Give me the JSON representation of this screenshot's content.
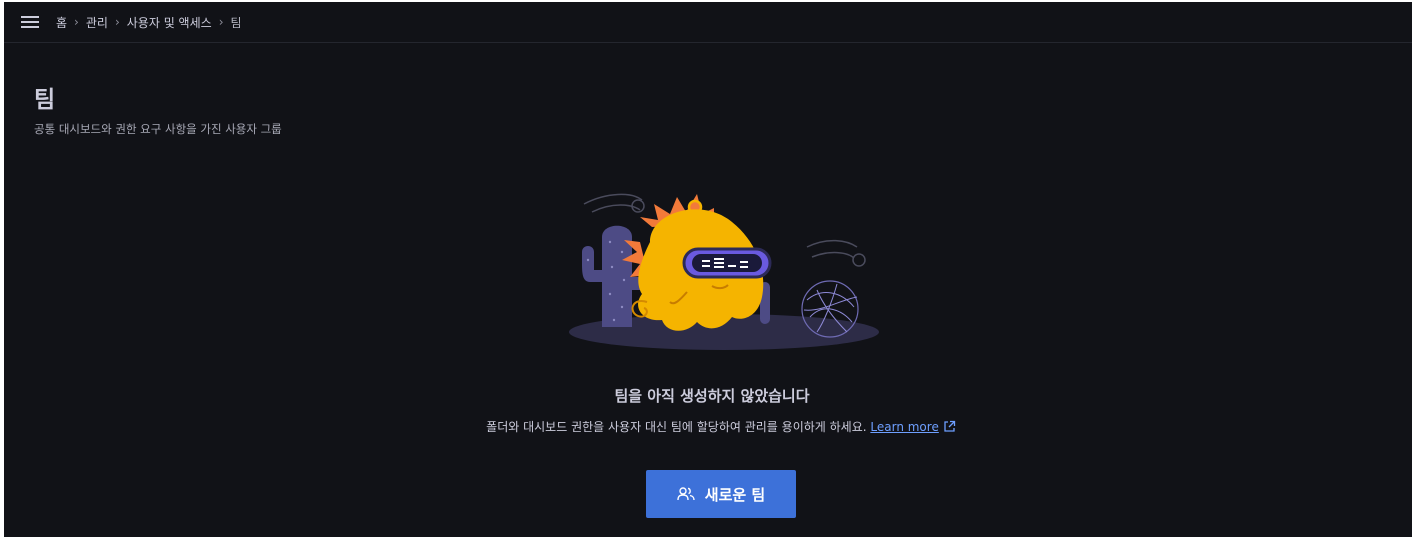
{
  "breadcrumb": {
    "items": [
      "홈",
      "관리",
      "사용자 및 액세스",
      "팀"
    ],
    "separator": "›"
  },
  "page": {
    "title": "팀",
    "subtitle": "공통 대시보드와 권한 요구 사항을 가진 사용자 그룹"
  },
  "empty_state": {
    "title": "팀을 아직 생성하지 않았습니다",
    "description": "폴더와 대시보드 권한을 사용자 대신 팀에 할당하여 관리를 용이하게 하세요.",
    "learn_more": "Learn more",
    "button_label": "새로운 팀"
  },
  "colors": {
    "background": "#111217",
    "primary_button": "#3d71d9",
    "link": "#6e9fff",
    "mascot": "#f5b400"
  },
  "icons": [
    "menu-icon",
    "users-icon",
    "external-link-icon"
  ]
}
